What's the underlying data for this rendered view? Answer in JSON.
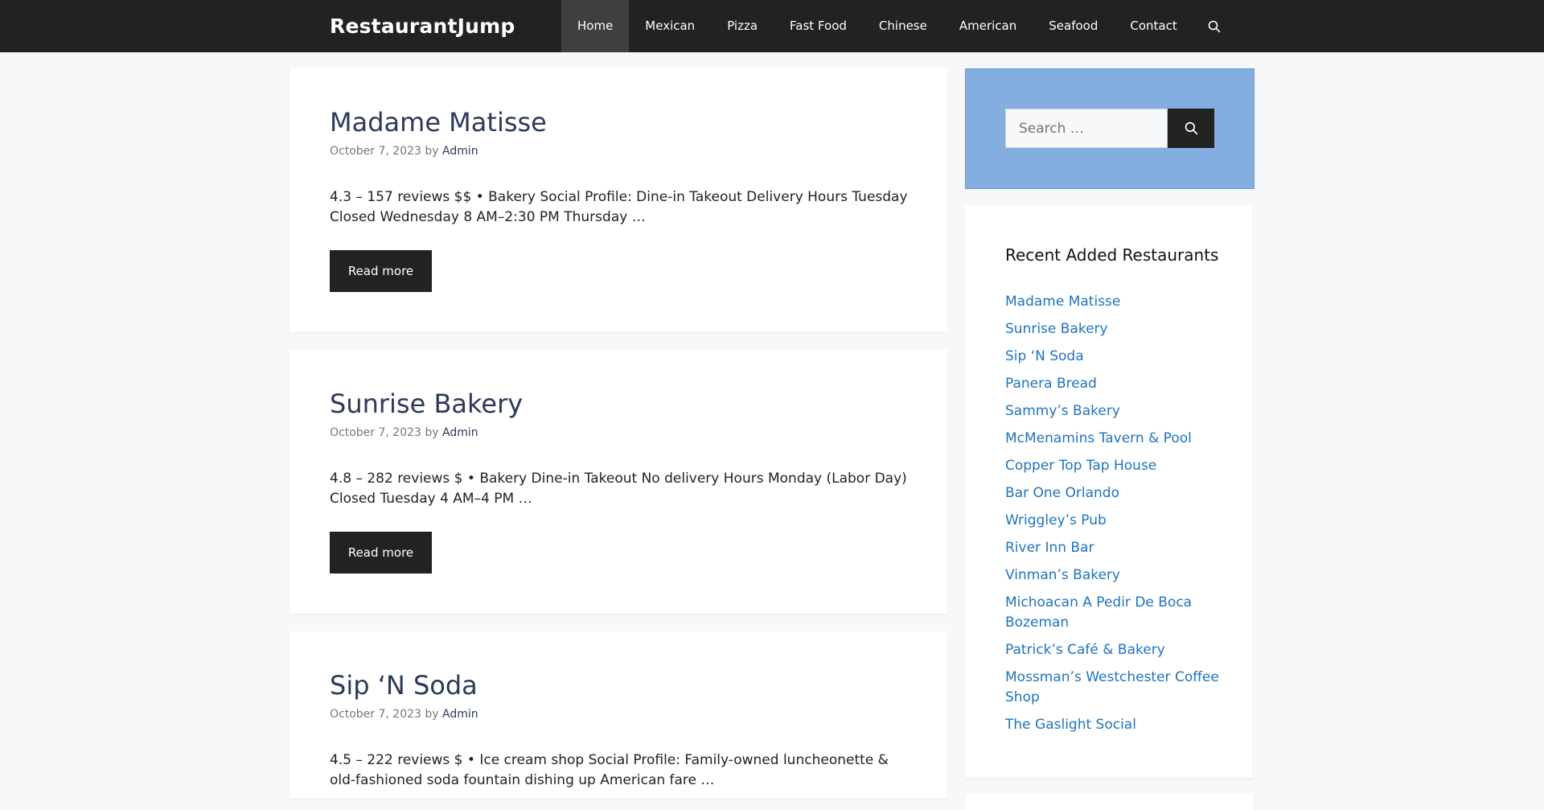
{
  "header": {
    "brand": "RestaurantJump",
    "nav": [
      "Home",
      "Mexican",
      "Pizza",
      "Fast Food",
      "Chinese",
      "American",
      "Seafood",
      "Contact"
    ],
    "search_icon": "search-icon"
  },
  "posts": [
    {
      "title": "Madame Matisse",
      "date": "October 7, 2023",
      "by": "by",
      "author": "Admin",
      "excerpt": "  4.3 – 157 reviews  $$ • Bakery Social Profile:    Dine-in    Takeout    Delivery Hours Tuesday Closed Wednesday 8 AM–2:30 PM Thursday …",
      "read_more": "Read more"
    },
    {
      "title": "Sunrise Bakery",
      "date": "October 7, 2023",
      "by": "by",
      "author": "Admin",
      "excerpt": "  4.8 – 282 reviews  $ • Bakery    Dine-in    Takeout    No delivery Hours Monday (Labor Day) Closed Tuesday 4 AM–4 PM …",
      "read_more": "Read more"
    },
    {
      "title": "Sip ‘N Soda",
      "date": "October 7, 2023",
      "by": "by",
      "author": "Admin",
      "excerpt": "  4.5 – 222 reviews  $ • Ice cream shop Social Profile: Family-owned luncheonette & old-fashioned soda fountain dishing up American fare …"
    }
  ],
  "sidebar": {
    "search_placeholder": "Search …",
    "recent_title": "Recent Added Restaurants",
    "recent": [
      "Madame Matisse",
      "Sunrise Bakery",
      "Sip ‘N Soda",
      "Panera Bread",
      "Sammy’s Bakery",
      "McMenamins Tavern & Pool",
      "Copper Top Tap House",
      "Bar One Orlando",
      "Wriggley’s Pub",
      "River Inn Bar",
      "Vinman’s Bakery",
      "Michoacan A Pedir De Boca Bozeman",
      "Patrick’s Café & Bakery",
      "Mossman’s Westchester Coffee Shop",
      "The Gaslight Social"
    ]
  },
  "colors": {
    "header_bg": "#222222",
    "link": "#1e73be",
    "title": "#2b3a5a",
    "search_widget_bg": "#84aee0"
  }
}
